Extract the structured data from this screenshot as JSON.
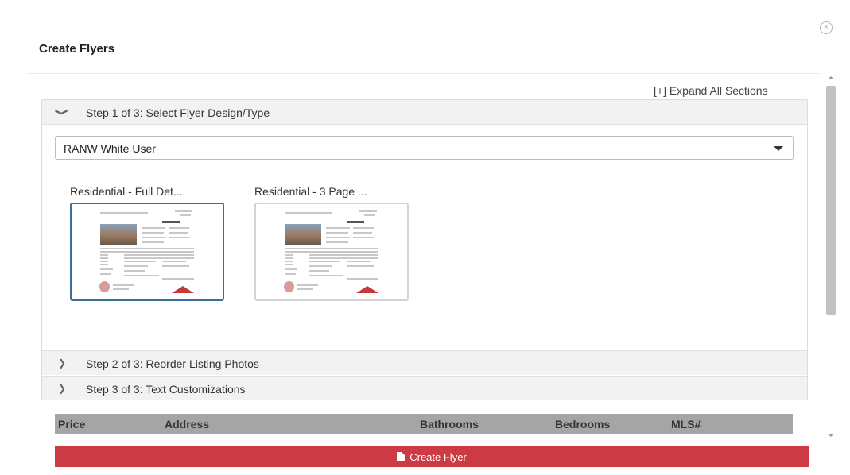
{
  "modal": {
    "title": "Create Flyers",
    "close_glyph": "×"
  },
  "expand_all_label": "[+] Expand All Sections",
  "steps": [
    {
      "label": "Step 1 of 3: Select Flyer Design/Type",
      "expanded": true,
      "chevron": "❯",
      "icon": "chevron-down-icon"
    },
    {
      "label": "Step 2 of 3: Reorder Listing Photos",
      "expanded": false,
      "chevron": "❯",
      "icon": "chevron-right-icon"
    },
    {
      "label": "Step 3 of 3: Text Customizations",
      "expanded": false,
      "chevron": "❯",
      "icon": "chevron-right-icon"
    }
  ],
  "design_select": {
    "selected": "RANW White User"
  },
  "templates": [
    {
      "name": "Residential - Full Det...",
      "selected": true
    },
    {
      "name": "Residential - 3 Page ...",
      "selected": false
    }
  ],
  "results_table": {
    "columns": [
      "Price",
      "Address",
      "Bathrooms",
      "Bedrooms",
      "MLS#"
    ]
  },
  "create_button": {
    "label": "Create Flyer",
    "icon": "document-icon"
  },
  "colors": {
    "accent_red": "#cc3a44",
    "selected_border": "#3a6f9b",
    "table_header": "#a5a5a5",
    "step_header": "#f2f2f2"
  }
}
